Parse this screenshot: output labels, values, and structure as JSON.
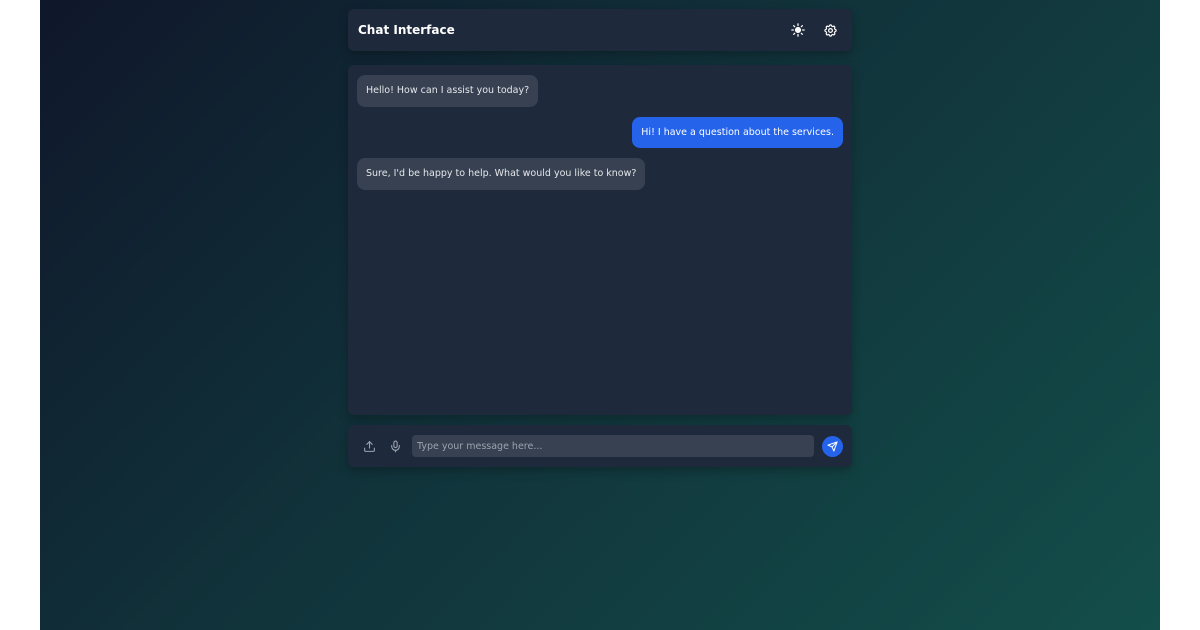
{
  "header": {
    "title": "Chat Interface",
    "theme_icon": "sun-icon",
    "settings_icon": "gear-icon"
  },
  "messages": [
    {
      "role": "bot",
      "text": "Hello! How can I assist you today?"
    },
    {
      "role": "user",
      "text": "Hi! I have a question about the services."
    },
    {
      "role": "bot",
      "text": "Sure, I'd be happy to help. What would you like to know?"
    }
  ],
  "composer": {
    "upload_icon": "upload-icon",
    "mic_icon": "microphone-icon",
    "placeholder": "Type your message here...",
    "value": "",
    "send_icon": "send-icon"
  },
  "colors": {
    "accent": "#2563eb",
    "panel": "#1e293b",
    "bot_bubble": "#374151"
  }
}
